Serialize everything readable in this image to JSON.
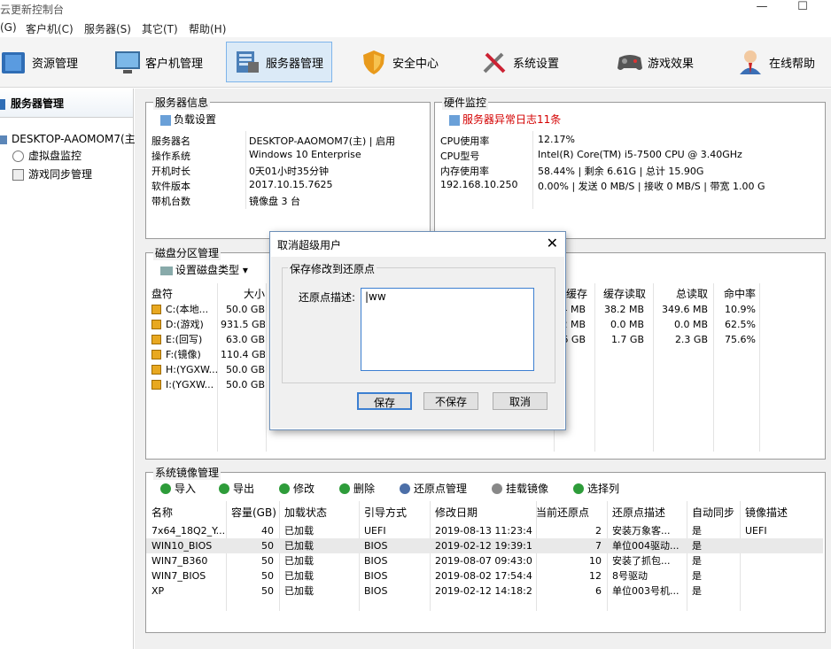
{
  "window": {
    "title": "云更新控制台",
    "minimize": "—",
    "maximize": "☐"
  },
  "menu": [
    {
      "label": "(G)"
    },
    {
      "label": "客户机(C)"
    },
    {
      "label": "服务器(S)"
    },
    {
      "label": "其它(T)"
    },
    {
      "label": "帮助(H)"
    }
  ],
  "toolbar": [
    {
      "label": "资源管理",
      "icon": "book-icon"
    },
    {
      "label": "客户机管理",
      "icon": "monitor-icon"
    },
    {
      "label": "服务器管理",
      "icon": "server-icon",
      "selected": true
    },
    {
      "label": "安全中心",
      "icon": "shield-icon"
    },
    {
      "label": "系统设置",
      "icon": "tools-icon"
    },
    {
      "label": "游戏效果",
      "icon": "gamepad-icon"
    },
    {
      "label": "在线帮助",
      "icon": "support-person-icon"
    }
  ],
  "sidebar": {
    "title": "服务器管理",
    "server": "DESKTOP-AAOMOM7(主)",
    "items": [
      {
        "label": "虚拟盘监控"
      },
      {
        "label": "游戏同步管理"
      }
    ]
  },
  "server_info": {
    "caption": "服务器信息",
    "action": "负载设置",
    "rows": [
      {
        "key": "服务器名",
        "value": "DESKTOP-AAOMOM7(主) | 启用"
      },
      {
        "key": "操作系统",
        "value": "Windows 10 Enterprise"
      },
      {
        "key": "开机时长",
        "value": "0天01小时35分钟"
      },
      {
        "key": "软件版本",
        "value": "2017.10.15.7625"
      },
      {
        "key": "带机台数",
        "value": "镜像盘 3 台"
      }
    ]
  },
  "hardware": {
    "caption": "硬件监控",
    "alert": "服务器异常日志11条",
    "alert_color": "#d40000",
    "rows": [
      {
        "key": "CPU使用率",
        "value": "12.17%"
      },
      {
        "key": "CPU型号",
        "value": "Intel(R) Core(TM) i5-7500 CPU @ 3.40GHz"
      },
      {
        "key": "内存使用率",
        "value": "58.44% | 剩余 6.61G | 总计 15.90G"
      },
      {
        "key": "192.168.10.250",
        "value": "0.00% | 发送 0 MB/S | 接收 0 MB/S | 带宽 1.00 G"
      }
    ]
  },
  "disk": {
    "caption": "磁盘分区管理",
    "action": "设置磁盘类型",
    "columns": [
      "盘符",
      "大小",
      "缓存",
      "缓存读取",
      "总读取",
      "命中率"
    ],
    "rows": [
      {
        "drive": "C:(本地...",
        "size": "50.0 GB",
        "cache": ".4 MB",
        "cache_read": "38.2 MB",
        "total_read": "349.6 MB",
        "hit": "10.9%"
      },
      {
        "drive": "D:(游戏)",
        "size": "931.5 GB",
        "cache": ".2 MB",
        "cache_read": "0.0 MB",
        "total_read": "0.0 MB",
        "hit": "62.5%"
      },
      {
        "drive": "E:(回写)",
        "size": "63.0 GB",
        "cache": ".6 GB",
        "cache_read": "1.7 GB",
        "total_read": "2.3 GB",
        "hit": "75.6%"
      },
      {
        "drive": "F:(镜像)",
        "size": "110.4 GB",
        "cache": "",
        "cache_read": "",
        "total_read": "",
        "hit": ""
      },
      {
        "drive": "H:(YGXW...",
        "size": "50.0 GB",
        "cache": "",
        "cache_read": "",
        "total_read": "",
        "hit": ""
      },
      {
        "drive": "I:(YGXW...",
        "size": "50.0 GB",
        "cache": "",
        "cache_read": "",
        "total_read": "",
        "hit": ""
      }
    ]
  },
  "images": {
    "caption": "系统镜像管理",
    "actions": [
      {
        "label": "导入",
        "icon": "import-icon",
        "color": "#2e9c3a"
      },
      {
        "label": "导出",
        "icon": "export-icon",
        "color": "#2e9c3a"
      },
      {
        "label": "修改",
        "icon": "check-icon",
        "color": "#2e9c3a"
      },
      {
        "label": "删除",
        "icon": "delete-icon",
        "color": "#2e9c3a"
      },
      {
        "label": "还原点管理",
        "icon": "restore-icon",
        "color": "#4c6fa8"
      },
      {
        "label": "挂载镜像",
        "icon": "disc-icon",
        "color": "#888888"
      },
      {
        "label": "选择列",
        "icon": "columns-icon",
        "color": "#2e9c3a"
      }
    ],
    "columns": [
      "名称",
      "容量(GB)",
      "加载状态",
      "引导方式",
      "修改日期",
      "当前还原点",
      "还原点描述",
      "自动同步",
      "镜像描述"
    ],
    "rows": [
      {
        "name": "7x64_18Q2_Y...",
        "cap": "40",
        "state": "已加载",
        "boot": "UEFI",
        "date": "2019-08-13 11:23:43",
        "point": "2",
        "desc": "安装万象客...",
        "sync": "是",
        "img_desc": "UEFI"
      },
      {
        "name": "WIN10_BIOS",
        "cap": "50",
        "state": "已加载",
        "boot": "BIOS",
        "date": "2019-02-12 19:39:17",
        "point": "7",
        "desc": "单位004驱动...",
        "sync": "是",
        "img_desc": ""
      },
      {
        "name": "WIN7_B360",
        "cap": "50",
        "state": "已加载",
        "boot": "BIOS",
        "date": "2019-08-07 09:43:02",
        "point": "10",
        "desc": "安装了抓包...",
        "sync": "是",
        "img_desc": ""
      },
      {
        "name": "WIN7_BIOS",
        "cap": "50",
        "state": "已加载",
        "boot": "BIOS",
        "date": "2019-08-02 17:54:48",
        "point": "12",
        "desc": "8号驱动",
        "sync": "是",
        "img_desc": ""
      },
      {
        "name": "XP",
        "cap": "50",
        "state": "已加载",
        "boot": "BIOS",
        "date": "2019-02-12 14:18:28",
        "point": "6",
        "desc": "单位003号机...",
        "sync": "是",
        "img_desc": ""
      }
    ]
  },
  "dialog": {
    "title": "取消超级用户",
    "close": "✕",
    "group": "保存修改到还原点",
    "label": "还原点描述:",
    "value": "ww",
    "buttons": {
      "save": "保存",
      "nosave": "不保存",
      "cancel": "取消"
    }
  }
}
